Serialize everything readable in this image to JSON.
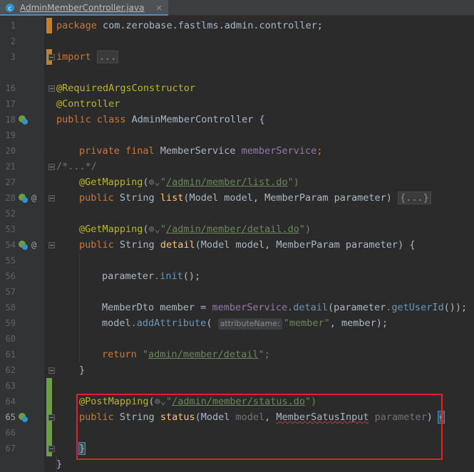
{
  "tab": {
    "filename": "AdminMemberController.java",
    "close": "×"
  },
  "line_numbers": [
    "1",
    "2",
    "3",
    "16",
    "17",
    "18",
    "19",
    "20",
    "21",
    "27",
    "28",
    "52",
    "53",
    "54",
    "55",
    "56",
    "57",
    "58",
    "59",
    "60",
    "61",
    "62",
    "63",
    "64",
    "65",
    "66",
    "67"
  ],
  "current_line": "65",
  "code": {
    "l1_kw": "package",
    "l1_rest": " com.zerobase.fastlms.admin.controller;",
    "l3_kw": "import",
    "l3_fold": "...",
    "l16": "@RequiredArgsConstructor",
    "l17": "@Controller",
    "l18_kw": "public class",
    "l18_name": " AdminMemberController",
    "l18_brace": " {",
    "l20_kw": "private final",
    "l20_type": " MemberService ",
    "l20_field": "memberService",
    "l20_end": ";",
    "l21": "/*...*/",
    "l27_ann": "@GetMapping",
    "l27_open": "(",
    "l27_quote": "\"",
    "l27_url": "/admin/member/list.do",
    "l27_close": "\")",
    "l28_kw": "public",
    "l28_type": " String ",
    "l28_meth": "list",
    "l28_params": "(Model model, MemberParam parameter) ",
    "l28_fold": "{...}",
    "l53_ann": "@GetMapping",
    "l53_open": "(",
    "l53_quote": "\"",
    "l53_url": "/admin/member/detail.do",
    "l53_close": "\")",
    "l54_kw": "public",
    "l54_type": " String ",
    "l54_meth": "detail",
    "l54_params": "(Model model, MemberParam parameter) {",
    "l56_var": "parameter",
    "l56_call": ".init",
    "l56_end": "();",
    "l58_type": "MemberDto member = ",
    "l58_field": "memberService",
    "l58_call": ".detail",
    "l58_args": "(parameter",
    "l58_call2": ".getUserId",
    "l58_end": "());",
    "l59_var": "model",
    "l59_call": ".addAttribute",
    "l59_open": "( ",
    "l59_hint": "attributeName:",
    "l59_str": "\"member\"",
    "l59_end": ", member);",
    "l61_kw": "return",
    "l61_q1": " \"",
    "l61_url": "admin/member/detail",
    "l61_q2": "\";",
    "l62": "}",
    "l64_ann": "@PostMapping",
    "l64_open": "(",
    "l64_quote": "\"",
    "l64_url": "/admin/member/status.do",
    "l64_close": "\")",
    "l65_kw": "public",
    "l65_type": " String ",
    "l65_meth": "status",
    "l65_p1": "(Model ",
    "l65_model": "model",
    "l65_p2": ", ",
    "l65_type2": "MemberSatusInput",
    "l65_p3": " ",
    "l65_param": "parameter",
    "l65_p4": ") ",
    "l65_brace": "{",
    "l67": "}",
    "l68": "}"
  },
  "colors": {
    "highlight_box": "#e21d2c",
    "change_marker_modified": "#c47f2c",
    "change_marker_added": "#6c9e46"
  }
}
